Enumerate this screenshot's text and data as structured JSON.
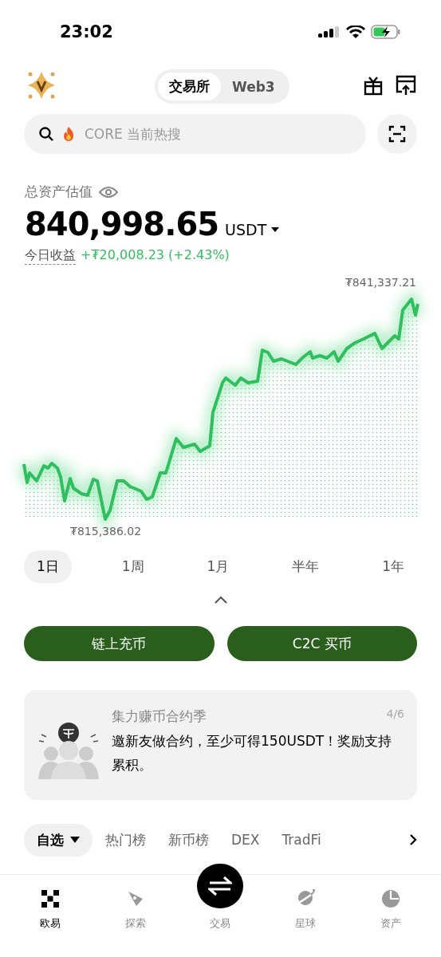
{
  "status_bar": {
    "time": "23:02"
  },
  "header": {
    "tabs": [
      {
        "label": "交易所",
        "selected": true
      },
      {
        "label": "Web3",
        "selected": false
      }
    ]
  },
  "search": {
    "placeholder": "CORE 当前热搜"
  },
  "assets": {
    "label": "总资产估值",
    "amount": "840,998.65",
    "currency": "USDT",
    "pnl_label": "今日收益",
    "pnl_value": "+₮20,008.23 (+2.43%)"
  },
  "chart": {
    "max_label": "₮841,337.21",
    "min_label": "₮815,386.02"
  },
  "periods": [
    {
      "label": "1日",
      "selected": true
    },
    {
      "label": "1周",
      "selected": false
    },
    {
      "label": "1月",
      "selected": false
    },
    {
      "label": "半年",
      "selected": false
    },
    {
      "label": "1年",
      "selected": false
    }
  ],
  "actions": [
    "链上充币",
    "C2C 买币"
  ],
  "banner": {
    "title": "集力赚币合约季",
    "page": "4/6",
    "text": "邀新友做合约，至少可得150USDT！奖励支持累积。"
  },
  "market_tabs": [
    {
      "label": "自选",
      "selected": true
    },
    {
      "label": "热门榜",
      "selected": false
    },
    {
      "label": "新币榜",
      "selected": false
    },
    {
      "label": "DEX",
      "selected": false
    },
    {
      "label": "TradFi",
      "selected": false
    }
  ],
  "nav": [
    {
      "label": "欧易",
      "kind": "home",
      "selected": true
    },
    {
      "label": "探索",
      "kind": "explore",
      "selected": false
    },
    {
      "label": "交易",
      "kind": "trade",
      "selected": false
    },
    {
      "label": "星球",
      "kind": "planet",
      "selected": false
    },
    {
      "label": "资产",
      "kind": "assets",
      "selected": false
    }
  ]
}
